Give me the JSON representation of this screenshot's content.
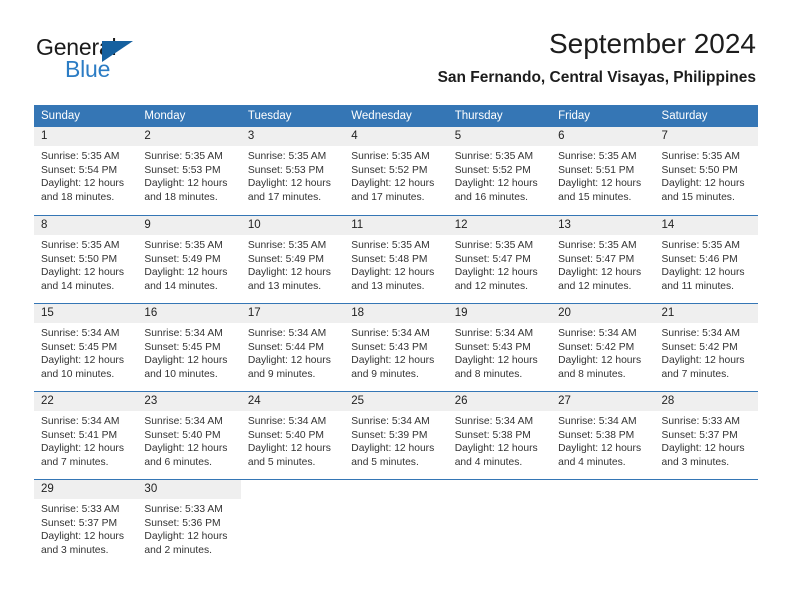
{
  "brand": {
    "name_part1": "General",
    "name_part2": "Blue",
    "accent_color": "#2b7cc4",
    "triangle_color": "#15609f"
  },
  "header": {
    "title": "September 2024",
    "subtitle": "San Fernando, Central Visayas, Philippines"
  },
  "theme": {
    "header_blue": "#3576b5",
    "daynum_band": "#efefef",
    "text": "#333333"
  },
  "weekdays": [
    "Sunday",
    "Monday",
    "Tuesday",
    "Wednesday",
    "Thursday",
    "Friday",
    "Saturday"
  ],
  "weeks": [
    [
      {
        "day": "1",
        "sunrise": "Sunrise: 5:35 AM",
        "sunset": "Sunset: 5:54 PM",
        "daylight": "Daylight: 12 hours and 18 minutes."
      },
      {
        "day": "2",
        "sunrise": "Sunrise: 5:35 AM",
        "sunset": "Sunset: 5:53 PM",
        "daylight": "Daylight: 12 hours and 18 minutes."
      },
      {
        "day": "3",
        "sunrise": "Sunrise: 5:35 AM",
        "sunset": "Sunset: 5:53 PM",
        "daylight": "Daylight: 12 hours and 17 minutes."
      },
      {
        "day": "4",
        "sunrise": "Sunrise: 5:35 AM",
        "sunset": "Sunset: 5:52 PM",
        "daylight": "Daylight: 12 hours and 17 minutes."
      },
      {
        "day": "5",
        "sunrise": "Sunrise: 5:35 AM",
        "sunset": "Sunset: 5:52 PM",
        "daylight": "Daylight: 12 hours and 16 minutes."
      },
      {
        "day": "6",
        "sunrise": "Sunrise: 5:35 AM",
        "sunset": "Sunset: 5:51 PM",
        "daylight": "Daylight: 12 hours and 15 minutes."
      },
      {
        "day": "7",
        "sunrise": "Sunrise: 5:35 AM",
        "sunset": "Sunset: 5:50 PM",
        "daylight": "Daylight: 12 hours and 15 minutes."
      }
    ],
    [
      {
        "day": "8",
        "sunrise": "Sunrise: 5:35 AM",
        "sunset": "Sunset: 5:50 PM",
        "daylight": "Daylight: 12 hours and 14 minutes."
      },
      {
        "day": "9",
        "sunrise": "Sunrise: 5:35 AM",
        "sunset": "Sunset: 5:49 PM",
        "daylight": "Daylight: 12 hours and 14 minutes."
      },
      {
        "day": "10",
        "sunrise": "Sunrise: 5:35 AM",
        "sunset": "Sunset: 5:49 PM",
        "daylight": "Daylight: 12 hours and 13 minutes."
      },
      {
        "day": "11",
        "sunrise": "Sunrise: 5:35 AM",
        "sunset": "Sunset: 5:48 PM",
        "daylight": "Daylight: 12 hours and 13 minutes."
      },
      {
        "day": "12",
        "sunrise": "Sunrise: 5:35 AM",
        "sunset": "Sunset: 5:47 PM",
        "daylight": "Daylight: 12 hours and 12 minutes."
      },
      {
        "day": "13",
        "sunrise": "Sunrise: 5:35 AM",
        "sunset": "Sunset: 5:47 PM",
        "daylight": "Daylight: 12 hours and 12 minutes."
      },
      {
        "day": "14",
        "sunrise": "Sunrise: 5:35 AM",
        "sunset": "Sunset: 5:46 PM",
        "daylight": "Daylight: 12 hours and 11 minutes."
      }
    ],
    [
      {
        "day": "15",
        "sunrise": "Sunrise: 5:34 AM",
        "sunset": "Sunset: 5:45 PM",
        "daylight": "Daylight: 12 hours and 10 minutes."
      },
      {
        "day": "16",
        "sunrise": "Sunrise: 5:34 AM",
        "sunset": "Sunset: 5:45 PM",
        "daylight": "Daylight: 12 hours and 10 minutes."
      },
      {
        "day": "17",
        "sunrise": "Sunrise: 5:34 AM",
        "sunset": "Sunset: 5:44 PM",
        "daylight": "Daylight: 12 hours and 9 minutes."
      },
      {
        "day": "18",
        "sunrise": "Sunrise: 5:34 AM",
        "sunset": "Sunset: 5:43 PM",
        "daylight": "Daylight: 12 hours and 9 minutes."
      },
      {
        "day": "19",
        "sunrise": "Sunrise: 5:34 AM",
        "sunset": "Sunset: 5:43 PM",
        "daylight": "Daylight: 12 hours and 8 minutes."
      },
      {
        "day": "20",
        "sunrise": "Sunrise: 5:34 AM",
        "sunset": "Sunset: 5:42 PM",
        "daylight": "Daylight: 12 hours and 8 minutes."
      },
      {
        "day": "21",
        "sunrise": "Sunrise: 5:34 AM",
        "sunset": "Sunset: 5:42 PM",
        "daylight": "Daylight: 12 hours and 7 minutes."
      }
    ],
    [
      {
        "day": "22",
        "sunrise": "Sunrise: 5:34 AM",
        "sunset": "Sunset: 5:41 PM",
        "daylight": "Daylight: 12 hours and 7 minutes."
      },
      {
        "day": "23",
        "sunrise": "Sunrise: 5:34 AM",
        "sunset": "Sunset: 5:40 PM",
        "daylight": "Daylight: 12 hours and 6 minutes."
      },
      {
        "day": "24",
        "sunrise": "Sunrise: 5:34 AM",
        "sunset": "Sunset: 5:40 PM",
        "daylight": "Daylight: 12 hours and 5 minutes."
      },
      {
        "day": "25",
        "sunrise": "Sunrise: 5:34 AM",
        "sunset": "Sunset: 5:39 PM",
        "daylight": "Daylight: 12 hours and 5 minutes."
      },
      {
        "day": "26",
        "sunrise": "Sunrise: 5:34 AM",
        "sunset": "Sunset: 5:38 PM",
        "daylight": "Daylight: 12 hours and 4 minutes."
      },
      {
        "day": "27",
        "sunrise": "Sunrise: 5:34 AM",
        "sunset": "Sunset: 5:38 PM",
        "daylight": "Daylight: 12 hours and 4 minutes."
      },
      {
        "day": "28",
        "sunrise": "Sunrise: 5:33 AM",
        "sunset": "Sunset: 5:37 PM",
        "daylight": "Daylight: 12 hours and 3 minutes."
      }
    ],
    [
      {
        "day": "29",
        "sunrise": "Sunrise: 5:33 AM",
        "sunset": "Sunset: 5:37 PM",
        "daylight": "Daylight: 12 hours and 3 minutes."
      },
      {
        "day": "30",
        "sunrise": "Sunrise: 5:33 AM",
        "sunset": "Sunset: 5:36 PM",
        "daylight": "Daylight: 12 hours and 2 minutes."
      },
      {
        "day": "",
        "sunrise": "",
        "sunset": "",
        "daylight": ""
      },
      {
        "day": "",
        "sunrise": "",
        "sunset": "",
        "daylight": ""
      },
      {
        "day": "",
        "sunrise": "",
        "sunset": "",
        "daylight": ""
      },
      {
        "day": "",
        "sunrise": "",
        "sunset": "",
        "daylight": ""
      },
      {
        "day": "",
        "sunrise": "",
        "sunset": "",
        "daylight": ""
      }
    ]
  ]
}
